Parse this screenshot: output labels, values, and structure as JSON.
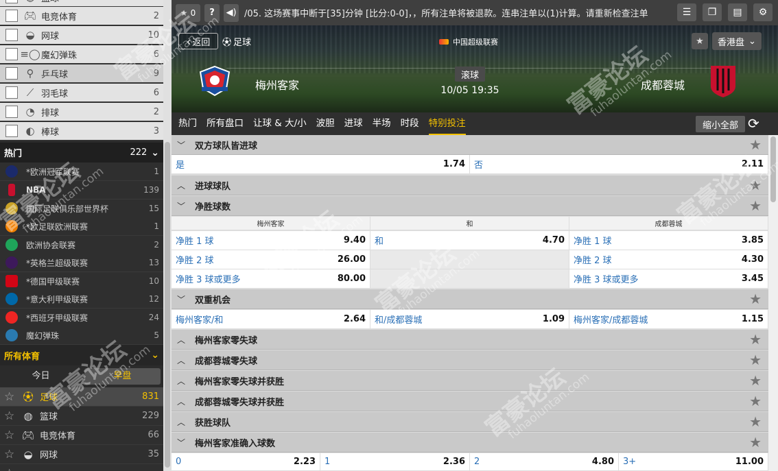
{
  "sidebar": {
    "sports_top": [
      {
        "label": "篮球",
        "count": "",
        "icon": "basketball-icon"
      },
      {
        "label": "电竞体育",
        "count": "2",
        "icon": "gamepad-icon"
      },
      {
        "label": "网球",
        "count": "10",
        "icon": "tennis-icon"
      },
      {
        "label": "魔幻弹珠",
        "count": "6",
        "icon": "pinball-icon"
      },
      {
        "label": "乒乓球",
        "count": "9",
        "icon": "table-tennis-icon"
      },
      {
        "label": "羽毛球",
        "count": "6",
        "icon": "badminton-icon"
      },
      {
        "label": "排球",
        "count": "2",
        "icon": "volleyball-icon"
      },
      {
        "label": "棒球",
        "count": "3",
        "icon": "baseball-icon"
      }
    ],
    "hot": {
      "label": "热门",
      "count": "222"
    },
    "leagues": [
      {
        "label": "*欧洲冠军联赛",
        "count": "1",
        "color": "#1b2a6b"
      },
      {
        "label": "NBA",
        "count": "139",
        "color": "#c8102e"
      },
      {
        "label": "国际足联俱乐部世界杯",
        "count": "15",
        "color": "#c9a227"
      },
      {
        "label": "*欧足联欧洲联赛",
        "count": "1",
        "color": "#f07f00"
      },
      {
        "label": "欧洲协会联赛",
        "count": "2",
        "color": "#1fa55a"
      },
      {
        "label": "*英格兰超级联赛",
        "count": "13",
        "color": "#3d195b"
      },
      {
        "label": "*德国甲级联赛",
        "count": "10",
        "color": "#d20515"
      },
      {
        "label": "*意大利甲级联赛",
        "count": "12",
        "color": "#0068a8"
      },
      {
        "label": "*西班牙甲级联赛",
        "count": "24",
        "color": "#ee2523"
      },
      {
        "label": "魔幻弹珠",
        "count": "5",
        "color": "#2a7ab0"
      }
    ],
    "all_sports": {
      "label": "所有体育"
    },
    "day_tabs": [
      "今日",
      "早盘"
    ],
    "sports_all": [
      {
        "label": "足球",
        "count": "831",
        "icon": "soccer-ball-icon"
      },
      {
        "label": "篮球",
        "count": "229",
        "icon": "basketball-icon"
      },
      {
        "label": "电竞体育",
        "count": "66",
        "icon": "gamepad-icon"
      },
      {
        "label": "网球",
        "count": "35",
        "icon": "tennis-icon"
      }
    ]
  },
  "topbar": {
    "fav_count": "0",
    "marquee": "/05. 这场赛事中断于[35]分钟 [比分:0-0]，，所有注单将被退款。连串注单以(1)计算。请重新检查注单"
  },
  "match": {
    "back_label": "返回",
    "sport_label": "足球",
    "league": "中国超级联赛",
    "odds_format": "香港盘",
    "status": "滚球",
    "time": "10/05 19:35",
    "home": "梅州客家",
    "away": "成都蓉城"
  },
  "nav": {
    "tabs": [
      "热门",
      "所有盘口",
      "让球 & 大/小",
      "波胆",
      "进球",
      "半场",
      "时段",
      "特别投注"
    ],
    "collapse_label": "缩小全部"
  },
  "markets": {
    "btts": {
      "title": "双方球队皆进球",
      "yes": {
        "label": "是",
        "odds": "1.74"
      },
      "no": {
        "label": "否",
        "odds": "2.11"
      }
    },
    "team_to_score": {
      "title": "进球球队"
    },
    "winning_margin": {
      "title": "净胜球数",
      "headers": [
        "梅州客家",
        "和",
        "成都蓉城"
      ],
      "rows": [
        {
          "home": {
            "label": "净胜 1 球",
            "odds": "9.40"
          },
          "draw": {
            "label": "和",
            "odds": "4.70"
          },
          "away": {
            "label": "净胜 1 球",
            "odds": "3.85"
          }
        },
        {
          "home": {
            "label": "净胜 2 球",
            "odds": "26.00"
          },
          "away": {
            "label": "净胜 2 球",
            "odds": "4.30"
          }
        },
        {
          "home": {
            "label": "净胜 3 球或更多",
            "odds": "80.00"
          },
          "away": {
            "label": "净胜 3 球或更多",
            "odds": "3.45"
          }
        }
      ]
    },
    "double_chance": {
      "title": "双重机会",
      "options": [
        {
          "label": "梅州客家/和",
          "odds": "2.64"
        },
        {
          "label": "和/成都蓉城",
          "odds": "1.09"
        },
        {
          "label": "梅州客家/成都蓉城",
          "odds": "1.15"
        }
      ]
    },
    "collapsed": [
      "梅州客家零失球",
      "成都蓉城零失球",
      "梅州客家零失球并获胜",
      "成都蓉城零失球并获胜",
      "获胜球队"
    ],
    "exact_goals": {
      "title": "梅州客家准确入球数",
      "options": [
        {
          "label": "0",
          "odds": "2.23"
        },
        {
          "label": "1",
          "odds": "2.36"
        },
        {
          "label": "2",
          "odds": "4.80"
        },
        {
          "label": "3+",
          "odds": "11.00"
        }
      ]
    }
  },
  "watermark": {
    "text": "富豪论坛",
    "sub": "fuhaoluntan.com"
  }
}
